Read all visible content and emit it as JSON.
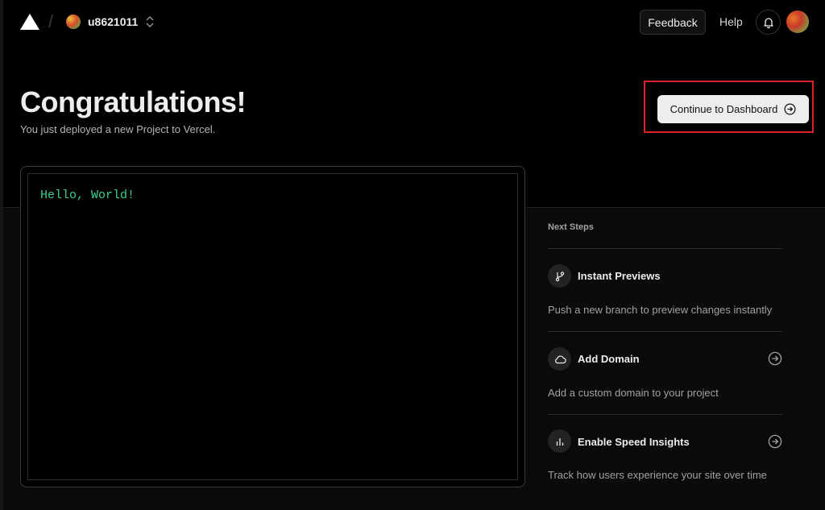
{
  "header": {
    "team_name": "u8621011",
    "feedback_label": "Feedback",
    "help_label": "Help",
    "logo_icon": "vercel-triangle-icon",
    "switcher_icon": "chevron-up-down-icon",
    "notification_icon": "bell-icon"
  },
  "hero": {
    "title": "Congratulations!",
    "subtitle": "You just deployed a new Project to Vercel.",
    "continue_label": "Continue to Dashboard",
    "continue_icon": "arrow-right-circle-icon"
  },
  "preview": {
    "content": "Hello, World!",
    "text_color": "#3ecf8e"
  },
  "next_steps": {
    "title": "Next Steps",
    "items": [
      {
        "title": "Instant Previews",
        "description": "Push a new branch to preview changes instantly",
        "icon": "git-branch-icon"
      },
      {
        "title": "Add Domain",
        "description": "Add a custom domain to your project",
        "icon": "cloud-icon"
      },
      {
        "title": "Enable Speed Insights",
        "description": "Track how users experience your site over time",
        "icon": "bar-chart-icon"
      }
    ]
  },
  "colors": {
    "background": "#000000",
    "highlight": "#e0202a",
    "primary_button": "#ededed"
  }
}
